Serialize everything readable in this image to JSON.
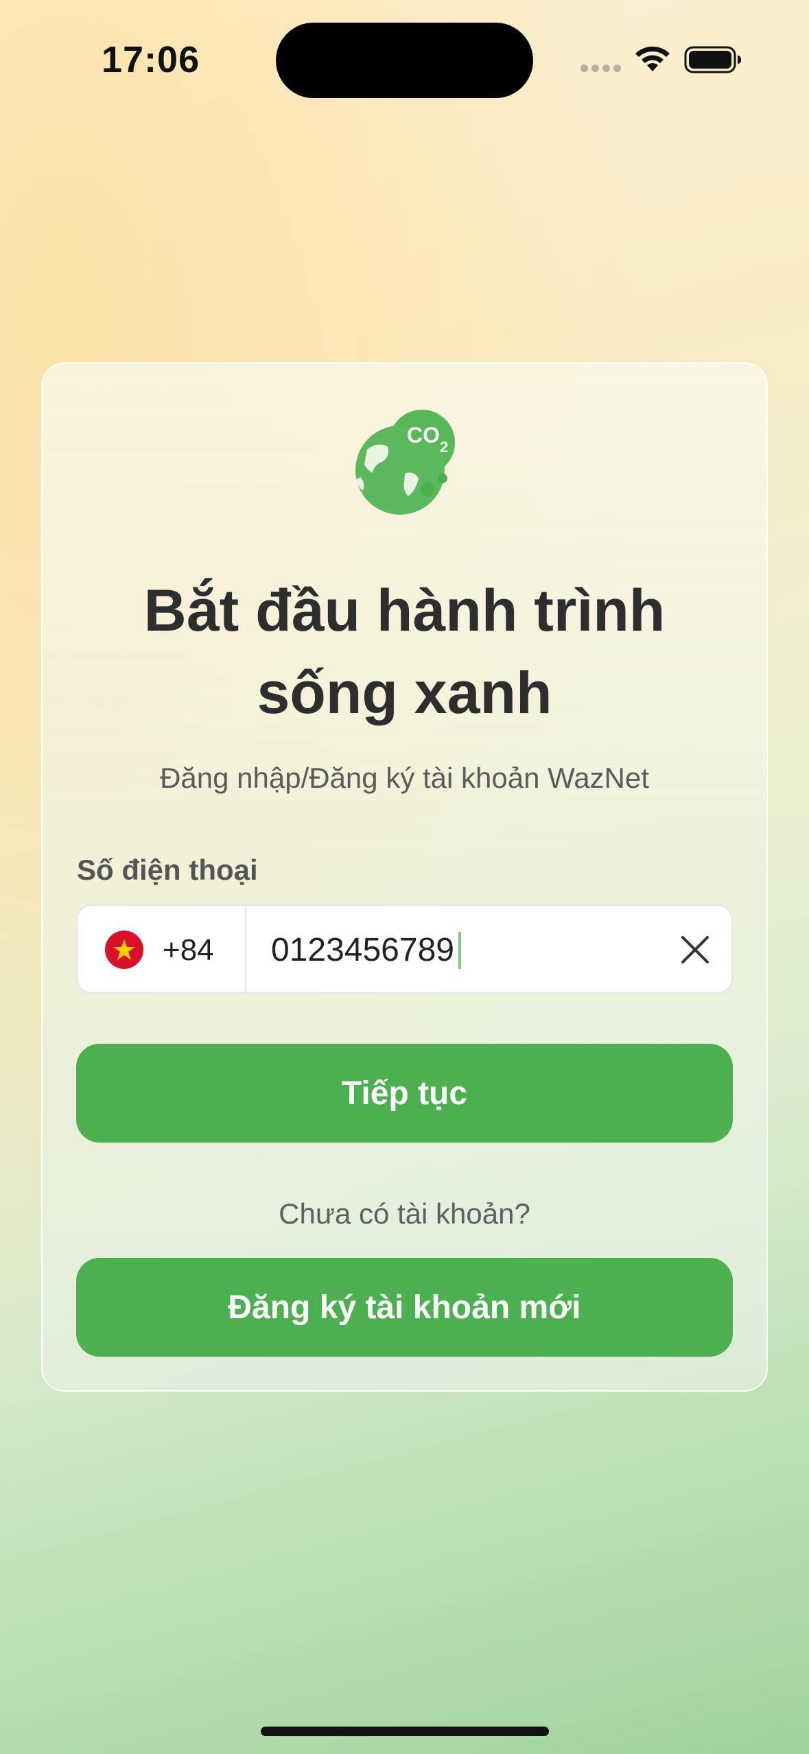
{
  "status_bar": {
    "time": "17:06"
  },
  "login": {
    "title_line1": "Bắt đầu hành trình",
    "title_line2": "sống xanh",
    "subtitle": "Đăng nhập/Đăng ký tài khoản WazNet",
    "phone_label": "Số điện thoại",
    "country_code": "+84",
    "phone_value": "0123456789",
    "continue_label": "Tiếp tục",
    "no_account_text": "Chưa có tài khoản?",
    "register_label": "Đăng ký tài khoản mới"
  },
  "logo": {
    "co2_text": "CO",
    "co2_sub": "2"
  },
  "icons": {
    "country_flag": "vietnam-flag-icon",
    "clear": "close-icon",
    "logo": "earth-co2-logo"
  },
  "colors": {
    "accent": "#4caf50",
    "title": "#2e2e2e",
    "flag_red": "#d8102a",
    "flag_star": "#ffd200"
  }
}
